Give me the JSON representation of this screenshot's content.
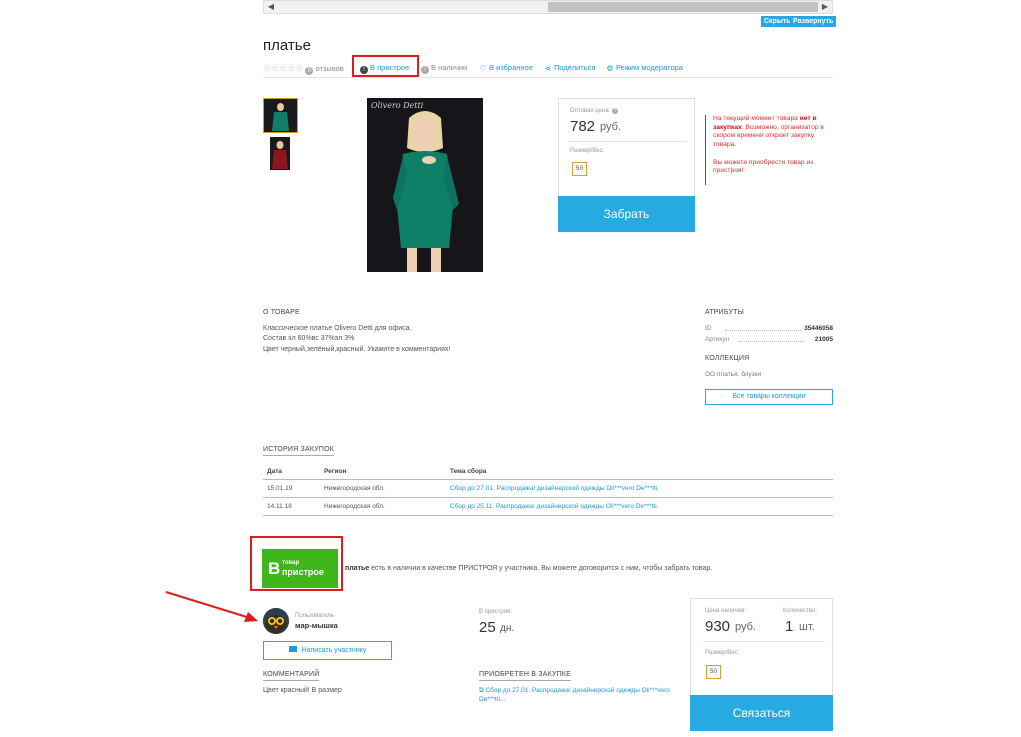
{
  "toolbar": {
    "hide_label": "Скрыть",
    "expand_label": "Развернуть"
  },
  "product": {
    "title": "платье",
    "reviews_label": "отзывов",
    "reviews_count": "0",
    "tag_pristroe": "В пристрое",
    "tag_available": "В наличии",
    "favorites": "В избранное",
    "share": "Поделиться",
    "moderator": "Режим модератора",
    "photo_brand": "Olivero Detti"
  },
  "price_box": {
    "label": "Оптовая цена:",
    "value": "782",
    "currency": "руб.",
    "size_label": "Размер/Вес:",
    "size_value": "50",
    "button": "Забрать"
  },
  "notice": {
    "part1": "На текущий момент товара ",
    "bold": "нет в закупках",
    "part2": ". Возможно, организатор в скором времени откроет закупку товара.",
    "part3": "Вы можете приобрести товар из пристроя!"
  },
  "about": {
    "title": "О ТОВАРЕ",
    "lines": [
      "Классическое платье Olivero Detti для офиса.",
      "Состав хл 60%вс 37%эл 3%",
      "Цвет черный,зелёный,красный. Укажите в комментариях!"
    ]
  },
  "attributes": {
    "title": "АТРИБУТЫ",
    "rows": [
      {
        "key": "ID",
        "value": "35446058"
      },
      {
        "key": "Артикул",
        "value": "21005"
      }
    ]
  },
  "collection": {
    "title": "КОЛЛЕКЦИЯ",
    "text": "ОО платья, блузки",
    "button": "Все товары коллекции"
  },
  "history": {
    "title": "ИСТОРИЯ ЗАКУПОК",
    "headers": [
      "Дата",
      "Регион",
      "Тема сбора"
    ],
    "rows": [
      [
        "15.01.19",
        "Нижегородская обл.",
        "Сбор до 27.01. Распродажа! дизайнерской одежды Oli***vero De***tti."
      ],
      [
        "14.11.18",
        "Нижегородская обл.",
        "Сбор до 25.11. Распродажа! дизайнерской одежды Oli***vero De***tti."
      ]
    ]
  },
  "badge": {
    "letter": "В",
    "small": "товар",
    "big": "пристрое",
    "text_bold": "платье",
    "text_rest": " есть в наличии в качестве ПРИСТРОЯ у участника. Вы можете договорится с ним, чтобы забрать товар."
  },
  "seller": {
    "user_label": "Пользователь",
    "user_name": "мар-мышка",
    "write_button": "Написать участнику",
    "pristroe_label": "В пристрое:",
    "pristroe_days": "25",
    "pristroe_unit": "дн.",
    "comment_title": "КОММЕНТАРИЙ",
    "comment_text": "Цвет красный! В размер",
    "acquired_title": "ПРИОБРЕТЕН В ЗАКУПКЕ",
    "acquired_link": "Сбор до 27.01. Распродажа! дизайнерской одежды Oli***vero De***tti..."
  },
  "avail_box": {
    "price_label": "Цена наличия:",
    "price_value": "930",
    "currency": "руб.",
    "qty_label": "Количество:",
    "qty_value": "1",
    "qty_unit": "шт.",
    "size_label": "Размер/Вес:",
    "size_value": "50",
    "button": "Связаться"
  },
  "colors": {
    "accent": "#27a9e1",
    "highlight_red": "#e01c1c",
    "badge_green": "#3fb71a"
  }
}
